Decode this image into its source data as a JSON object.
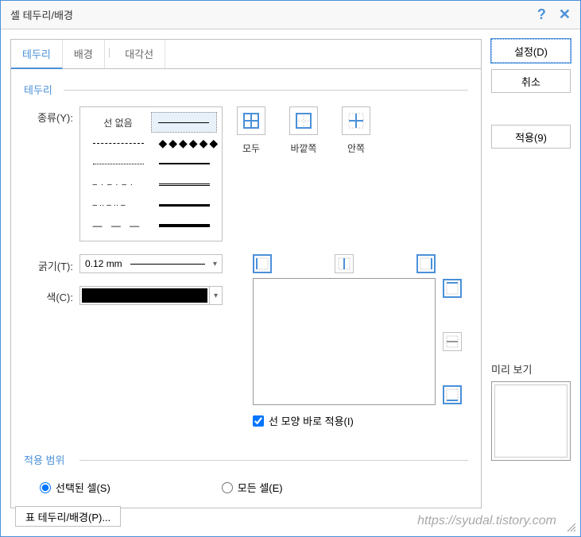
{
  "titlebar": {
    "title": "셀 테두리/배경"
  },
  "tabs": {
    "border": "테두리",
    "background": "배경",
    "diagonal": "대각선"
  },
  "section": {
    "border_title": "테두리",
    "type_label": "종류(Y):",
    "line_none": "선 없음",
    "thickness_label": "굵기(T):",
    "thickness_value": "0.12 mm",
    "color_label": "색(C):",
    "apply_line_shape": "선 모양 바로 적용(I)"
  },
  "border_buttons": {
    "all": "모두",
    "outer": "바깥쪽",
    "inner": "안쪽"
  },
  "scope": {
    "title": "적용 범위",
    "selected_cells": "선택된 셀(S)",
    "all_cells": "모든 셀(E)"
  },
  "actions": {
    "set": "설정(D)",
    "cancel": "취소",
    "apply": "적용(9)"
  },
  "preview": {
    "label": "미리 보기"
  },
  "bottom_button": "표 테두리/배경(P)...",
  "watermark": "https://syudal.tistory.com"
}
